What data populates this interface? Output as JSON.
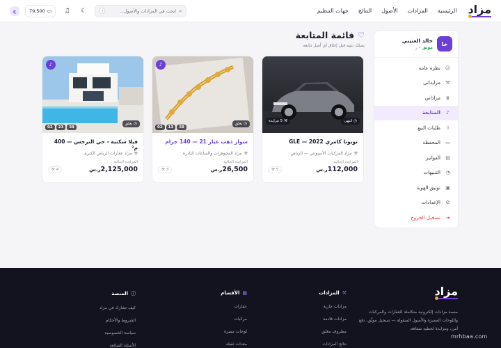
{
  "header": {
    "logo": "مزاد",
    "nav": [
      "الرئيسية",
      "المزادات",
      "الأصول",
      "النتائج",
      "جهات التنظيم"
    ],
    "search_placeholder": "ابحث في المزادات والأصول...",
    "search_kbd": "/",
    "balance": "79,500",
    "user_initial": "خ"
  },
  "sidebar": {
    "avatar": "خا",
    "name": "خالد العتيبي",
    "verified": "موثق",
    "tag": "• ر",
    "items": [
      {
        "label": "نظرة عامة",
        "icon": "user-icon",
        "glyph": "☺"
      },
      {
        "label": "مزايداتي",
        "icon": "gavel-icon",
        "glyph": "⚒"
      },
      {
        "label": "مزاداتي",
        "icon": "trophy-icon",
        "glyph": "♛"
      },
      {
        "label": "المتابعة",
        "icon": "bell-icon",
        "glyph": "♪"
      },
      {
        "label": "طلبات البيع",
        "icon": "upload-icon",
        "glyph": "⇧"
      },
      {
        "label": "المحفظة",
        "icon": "wallet-icon",
        "glyph": "▭"
      },
      {
        "label": "الفواتير",
        "icon": "invoice-icon",
        "glyph": "▤"
      },
      {
        "label": "التنبيهات",
        "icon": "alert-icon",
        "glyph": "◔"
      },
      {
        "label": "توثيق الهوية",
        "icon": "id-card-icon",
        "glyph": "▣"
      },
      {
        "label": "الإعدادات",
        "icon": "gear-icon",
        "glyph": "⚙"
      }
    ],
    "logout": "تسجيل الخروج"
  },
  "page": {
    "title": "قائمة المتابعة",
    "subtitle": "يصلك تنبيه قبل إغلاق أي أصل تتابعه"
  },
  "cards": [
    {
      "title": "تويوتا كامري 2022 — GLE",
      "seller": "مزاد المركبات الأسبوعي — الرياض",
      "status": "انتهى",
      "bids_chip": "5 مزايدة",
      "price_label": "المزايدة الحالية",
      "price": "112,000",
      "currency": "ر.س",
      "bids": "5",
      "timer": [],
      "highlight": false
    },
    {
      "title": "سوار ذهب عيار 21 — 140 جرام",
      "seller": "مزاد المجوهرات والساعات النادرة",
      "status": "يغلق",
      "bids_chip": "",
      "price_label": "المزايدة الحالية",
      "price": "26,500",
      "currency": "ر.س",
      "bids": "3",
      "timer": [
        "59",
        "13",
        "02"
      ],
      "highlight": true
    },
    {
      "title": "فيلا سكنية - حي النرجس — 400 م²",
      "seller": "مزاد عقارات الرياض الكبرى",
      "status": "يغلق",
      "bids_chip": "",
      "price_label": "المزايدة الحالية",
      "price": "2,125,000",
      "currency": "ر.س",
      "bids": "4",
      "timer": [
        "59",
        "23",
        "02"
      ],
      "highlight": false
    }
  ],
  "footer": {
    "logo": "مزاد",
    "description": "منصة مزادات إلكترونية متكاملة للعقارات والمركبات واللوحات المميزة والأصول المنقولة — تسجيل موثّق، دفع آمن، ومزايدة لحظية شفافة.",
    "columns": [
      {
        "title": "المزادات",
        "icon": "gavel-icon",
        "links": [
          "مزادات جارية",
          "مزادات قادمة",
          "مظروف مغلق",
          "نتائج المزادات"
        ]
      },
      {
        "title": "الأقسام",
        "icon": "grid-icon",
        "links": [
          "عقارات",
          "مركبات",
          "لوحات مميزة",
          "معدات ثقيلة"
        ]
      },
      {
        "title": "المنصة",
        "icon": "info-icon",
        "links": [
          "كيف تشارك في مزاد",
          "الشروط والأحكام",
          "سياسة الخصوصية",
          "الأسئلة الشائعة"
        ]
      }
    ],
    "watermark": "mrhbaa.com"
  },
  "colors": {
    "brand": "#6b3fd8",
    "accent": "#f2a51a",
    "footer_bg": "#13131f"
  }
}
